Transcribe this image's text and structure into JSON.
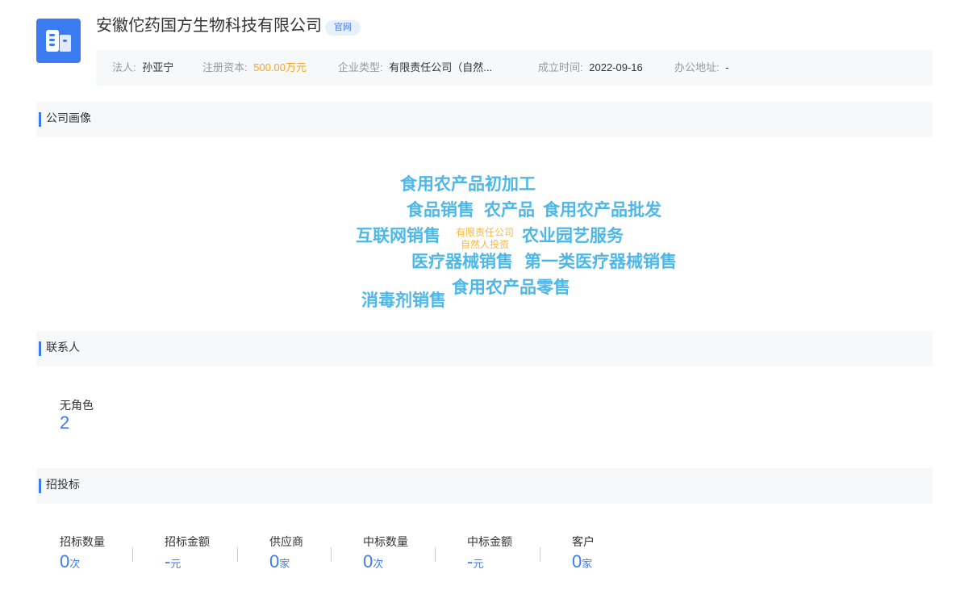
{
  "company": {
    "name": "安徽佗药国方生物科技有限公司",
    "badge": "官网",
    "logo_icon": "building-icon",
    "brand_color": "#3b7cf0",
    "info": {
      "legal_person_label": "法人:",
      "legal_person": "孙亚宁",
      "capital_label": "注册资本:",
      "capital": "500.00万元",
      "type_label": "企业类型:",
      "type": "有限责任公司（自然...",
      "founded_label": "成立时间:",
      "founded": "2022-09-16",
      "address_label": "办公地址:",
      "address": "-"
    }
  },
  "portrait": {
    "title": "公司画像",
    "words": [
      "食用农产品初加工",
      "食品销售",
      "农产品",
      "食用农产品批发",
      "互联网销售",
      "有限责任公司",
      "自然人投资",
      "农业园艺服务",
      "医疗器械销售",
      "第一类医疗器械销售",
      "食用农产品零售",
      "消毒剂销售"
    ]
  },
  "contacts": {
    "title": "联系人",
    "label": "无角色",
    "value": "2"
  },
  "bidding": {
    "title": "招投标",
    "stats": [
      {
        "label": "招标数量",
        "value": "0",
        "unit": "次"
      },
      {
        "label": "招标金额",
        "value": "-",
        "unit": "元"
      },
      {
        "label": "供应商",
        "value": "0",
        "unit": "家"
      },
      {
        "label": "中标数量",
        "value": "0",
        "unit": "次"
      },
      {
        "label": "中标金额",
        "value": "-",
        "unit": "元"
      },
      {
        "label": "客户",
        "value": "0",
        "unit": "家"
      }
    ]
  }
}
